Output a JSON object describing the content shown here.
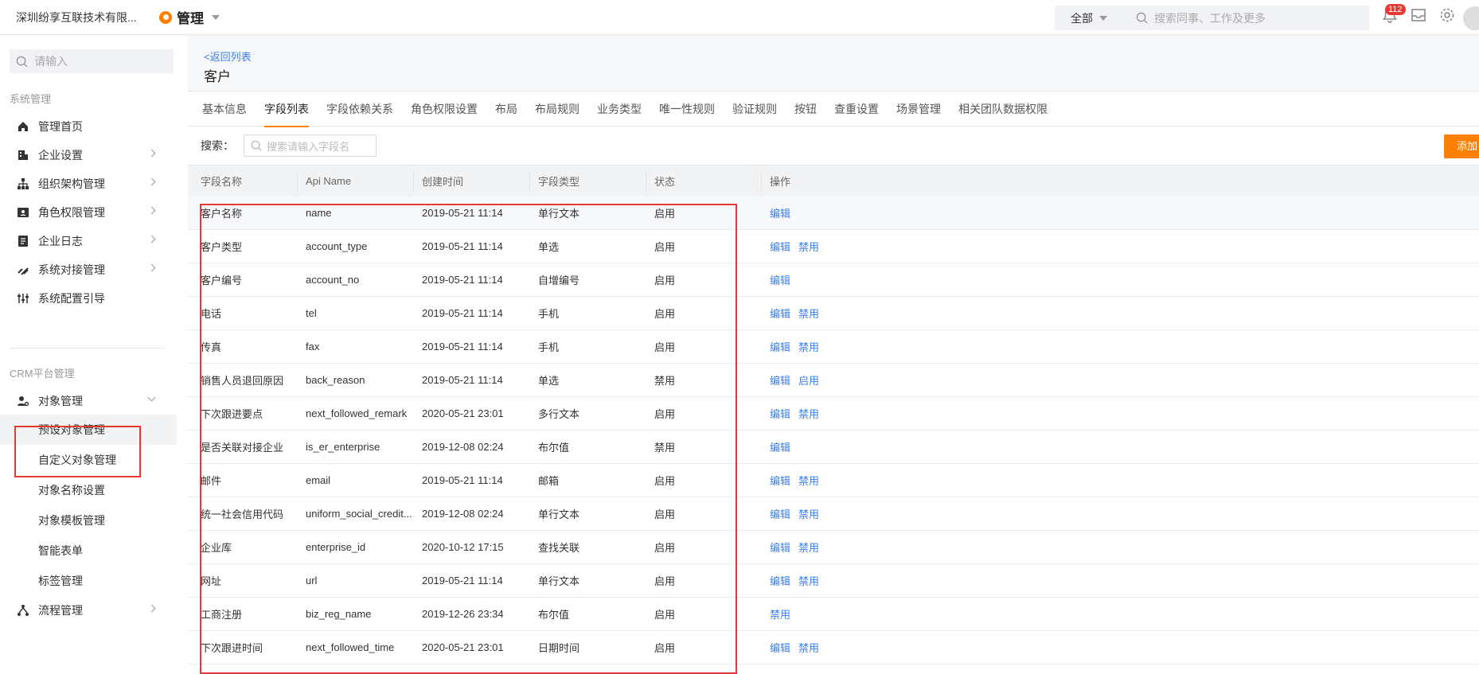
{
  "topbar": {
    "company": "深圳纷享互联技术有限...",
    "app_name": "管理",
    "search_scope": "全部",
    "search_placeholder": "搜索同事、工作及更多",
    "notification_count": "112"
  },
  "sidebar": {
    "search_placeholder": "请输入",
    "section_system": "系统管理",
    "system_items": [
      {
        "label": "管理首页",
        "icon": "home-icon"
      },
      {
        "label": "企业设置",
        "icon": "building-icon"
      },
      {
        "label": "组织架构管理",
        "icon": "org-chart-icon"
      },
      {
        "label": "角色权限管理",
        "icon": "id-card-icon"
      },
      {
        "label": "企业日志",
        "icon": "log-icon"
      },
      {
        "label": "系统对接管理",
        "icon": "link-icon"
      },
      {
        "label": "系统配置引导",
        "icon": "sliders-icon"
      }
    ],
    "section_crm": "CRM平台管理",
    "object_mgmt": "对象管理",
    "object_sub": [
      "预设对象管理",
      "自定义对象管理",
      "对象名称设置",
      "对象模板管理",
      "智能表单",
      "标签管理"
    ],
    "flow_mgmt": "流程管理"
  },
  "main": {
    "back_link": "<返回列表",
    "title": "客户",
    "tabs": [
      "基本信息",
      "字段列表",
      "字段依赖关系",
      "角色权限设置",
      "布局",
      "布局规则",
      "业务类型",
      "唯一性规则",
      "验证规则",
      "按钮",
      "查重设置",
      "场景管理",
      "相关团队数据权限"
    ],
    "active_tab": 1,
    "search_label": "搜索：",
    "search_placeholder": "搜索请输入字段名",
    "add_button": "添加",
    "columns": [
      "字段名称",
      "Api Name",
      "创建时间",
      "字段类型",
      "状态",
      "操作"
    ],
    "rows": [
      {
        "name": "客户名称",
        "api": "name",
        "created": "2019-05-21 11:14",
        "type": "单行文本",
        "status": "启用",
        "actions": [
          "编辑"
        ]
      },
      {
        "name": "客户类型",
        "api": "account_type",
        "created": "2019-05-21 11:14",
        "type": "单选",
        "status": "启用",
        "actions": [
          "编辑",
          "禁用"
        ]
      },
      {
        "name": "客户编号",
        "api": "account_no",
        "created": "2019-05-21 11:14",
        "type": "自增编号",
        "status": "启用",
        "actions": [
          "编辑"
        ]
      },
      {
        "name": "电话",
        "api": "tel",
        "created": "2019-05-21 11:14",
        "type": "手机",
        "status": "启用",
        "actions": [
          "编辑",
          "禁用"
        ]
      },
      {
        "name": "传真",
        "api": "fax",
        "created": "2019-05-21 11:14",
        "type": "手机",
        "status": "启用",
        "actions": [
          "编辑",
          "禁用"
        ]
      },
      {
        "name": "销售人员退回原因",
        "api": "back_reason",
        "created": "2019-05-21 11:14",
        "type": "单选",
        "status": "禁用",
        "actions": [
          "编辑",
          "启用"
        ]
      },
      {
        "name": "下次跟进要点",
        "api": "next_followed_remark",
        "created": "2020-05-21 23:01",
        "type": "多行文本",
        "status": "启用",
        "actions": [
          "编辑",
          "禁用"
        ]
      },
      {
        "name": "是否关联对接企业",
        "api": "is_er_enterprise",
        "created": "2019-12-08 02:24",
        "type": "布尔值",
        "status": "禁用",
        "actions": [
          "编辑"
        ]
      },
      {
        "name": "邮件",
        "api": "email",
        "created": "2019-05-21 11:14",
        "type": "邮箱",
        "status": "启用",
        "actions": [
          "编辑",
          "禁用"
        ]
      },
      {
        "name": "统一社会信用代码",
        "api": "uniform_social_credit...",
        "created": "2019-12-08 02:24",
        "type": "单行文本",
        "status": "启用",
        "actions": [
          "编辑",
          "禁用"
        ]
      },
      {
        "name": "企业库",
        "api": "enterprise_id",
        "created": "2020-10-12 17:15",
        "type": "查找关联",
        "status": "启用",
        "actions": [
          "编辑",
          "禁用"
        ]
      },
      {
        "name": "网址",
        "api": "url",
        "created": "2019-05-21 11:14",
        "type": "单行文本",
        "status": "启用",
        "actions": [
          "编辑",
          "禁用"
        ]
      },
      {
        "name": "工商注册",
        "api": "biz_reg_name",
        "created": "2019-12-26 23:34",
        "type": "布尔值",
        "status": "启用",
        "actions": [
          "禁用"
        ]
      },
      {
        "name": "下次跟进时间",
        "api": "next_followed_time",
        "created": "2020-05-21 23:01",
        "type": "日期时间",
        "status": "启用",
        "actions": [
          "编辑",
          "禁用"
        ]
      }
    ]
  },
  "colors": {
    "accent": "#ff8000",
    "link": "#3e7ee6",
    "highlight": "#e53935"
  }
}
